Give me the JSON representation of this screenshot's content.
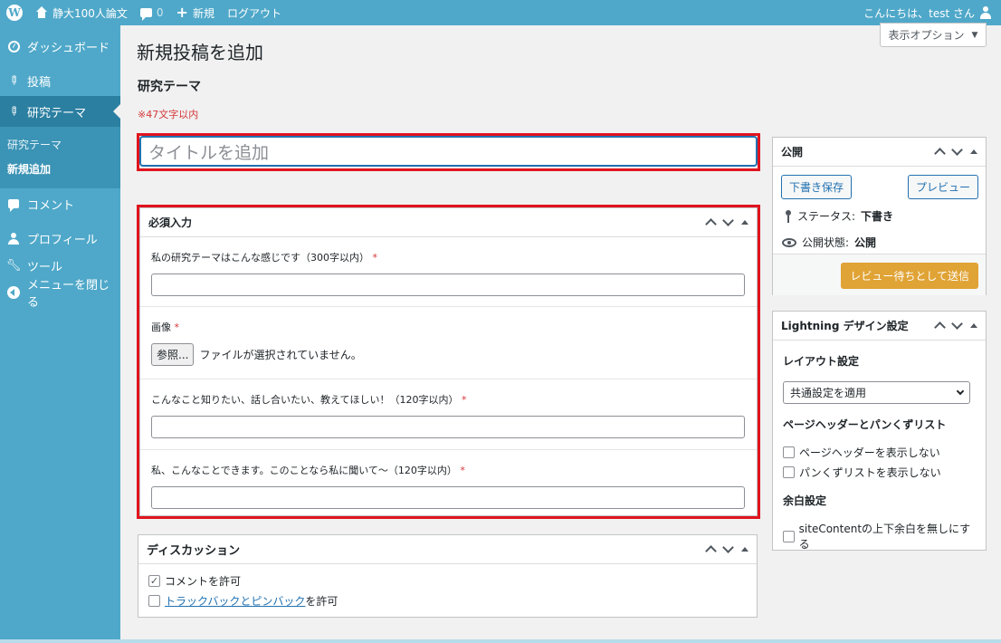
{
  "adminbar": {
    "site_name": "静大100人論文",
    "comments_count": "0",
    "new_label": "新規",
    "logout_label": "ログアウト",
    "greeting": "こんにちは、test さん"
  },
  "sidebar": {
    "items": [
      {
        "label": "ダッシュボード",
        "icon": "dashboard-icon"
      },
      {
        "label": "投稿",
        "icon": "pin-icon"
      },
      {
        "label": "研究テーマ",
        "icon": "pin-icon"
      },
      {
        "label": "コメント",
        "icon": "comment-icon"
      },
      {
        "label": "プロフィール",
        "icon": "user-icon"
      },
      {
        "label": "ツール",
        "icon": "wrench-icon"
      },
      {
        "label": "メニューを閉じる",
        "icon": "collapse-icon"
      }
    ],
    "submenu": [
      "研究テーマ",
      "新規追加"
    ]
  },
  "main": {
    "screen_options": "表示オプション",
    "page_title": "新規投稿を追加",
    "sub_title": "研究テーマ",
    "notice": "※47文字以内",
    "title_placeholder": "タイトルを追加"
  },
  "required_box": {
    "title": "必須入力",
    "field1_label": "私の研究テーマはこんな感じです（300字以内）",
    "field2_label": "画像",
    "file_button": "参照...",
    "file_status": "ファイルが選択されていません。",
    "field3_label": "こんなこと知りたい、話し合いたい、教えてほしい！（120字以内）",
    "field4_label": "私、こんなことできます。このことなら私に聞いて〜（120字以内）",
    "required_mark": "*"
  },
  "discussion_box": {
    "title": "ディスカッション",
    "allow_comments": "コメントを許可",
    "trackback_link": "トラックバックとピンバック",
    "trackback_suffix": "を許可"
  },
  "publish_box": {
    "title": "公開",
    "save_draft": "下書き保存",
    "preview": "プレビュー",
    "status_label": "ステータス:",
    "status_value": "下書き",
    "visibility_label": "公開状態:",
    "visibility_value": "公開",
    "submit": "レビュー待ちとして送信"
  },
  "lightning_box": {
    "title": "Lightning デザイン設定",
    "layout_heading": "レイアウト設定",
    "layout_select": "共通設定を適用",
    "header_heading": "ページヘッダーとパンくずリスト",
    "hide_header": "ページヘッダーを表示しない",
    "hide_breadcrumb": "パンくずリストを表示しない",
    "margin_heading": "余白設定",
    "no_margin": "siteContentの上下余白を無しにする"
  }
}
